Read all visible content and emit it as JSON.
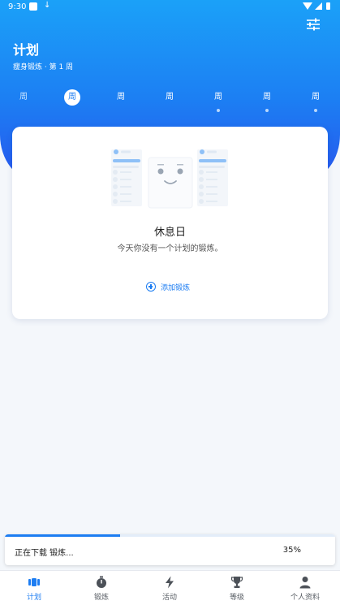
{
  "status_bar": {
    "time": "9:30",
    "download_glyph": "↓"
  },
  "header": {
    "title": "计划",
    "subtitle": "瘦身锻炼 · 第 1 周",
    "filter_icon": "sliders-icon"
  },
  "week": {
    "selected_index": 1,
    "days": [
      {
        "label": "周",
        "faded": true,
        "has_dot": false
      },
      {
        "label": "周",
        "faded": false,
        "has_dot": false
      },
      {
        "label": "周",
        "faded": false,
        "has_dot": false
      },
      {
        "label": "周",
        "faded": false,
        "has_dot": false
      },
      {
        "label": "周",
        "faded": false,
        "has_dot": true
      },
      {
        "label": "周",
        "faded": false,
        "has_dot": true
      },
      {
        "label": "周",
        "faded": false,
        "has_dot": true
      }
    ]
  },
  "rest_card": {
    "title": "休息日",
    "description": "今天你没有一个计划的锻炼。",
    "add_label": "添加锻炼",
    "illustration_icon": "sleeping-plan-illustration-icon"
  },
  "download": {
    "message": "正在下载 锻炼...",
    "percent_label": "35%",
    "progress": 0.35
  },
  "tabs": [
    {
      "label": "计划",
      "icon": "plan-icon",
      "active": true
    },
    {
      "label": "锻炼",
      "icon": "stopwatch-icon",
      "active": false
    },
    {
      "label": "活动",
      "icon": "bolt-icon",
      "active": false
    },
    {
      "label": "等级",
      "icon": "trophy-icon",
      "active": false
    },
    {
      "label": "个人资料",
      "icon": "person-icon",
      "active": false
    }
  ],
  "colors": {
    "accent": "#1d7df2",
    "hero_top": "#1ba1f8",
    "hero_bottom": "#2757ee",
    "inactive_tab": "#5a5f66"
  }
}
